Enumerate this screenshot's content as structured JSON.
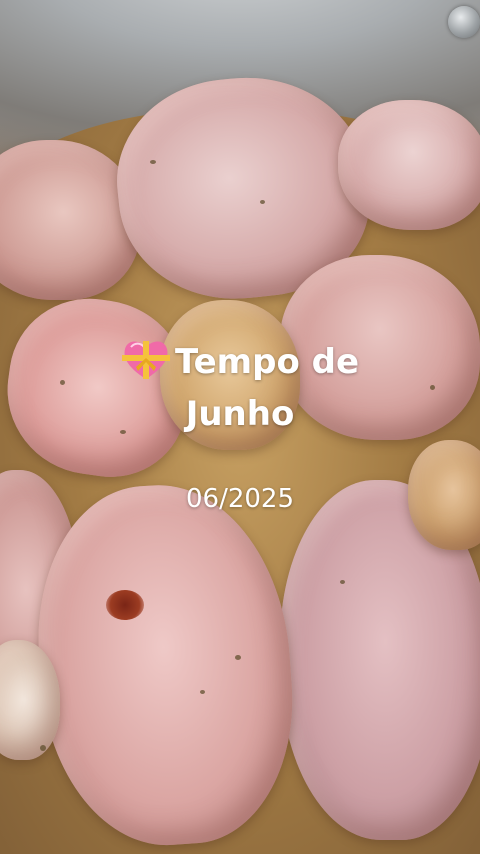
{
  "overlay": {
    "emoji_icon": "heart-with-ribbon-icon",
    "title_line1": "Tempo de",
    "title_line2": "Junho",
    "date": "06/2025"
  },
  "colors": {
    "text": "#ffffff",
    "heart": "#f06aa8",
    "ribbon": "#f5c23c"
  }
}
